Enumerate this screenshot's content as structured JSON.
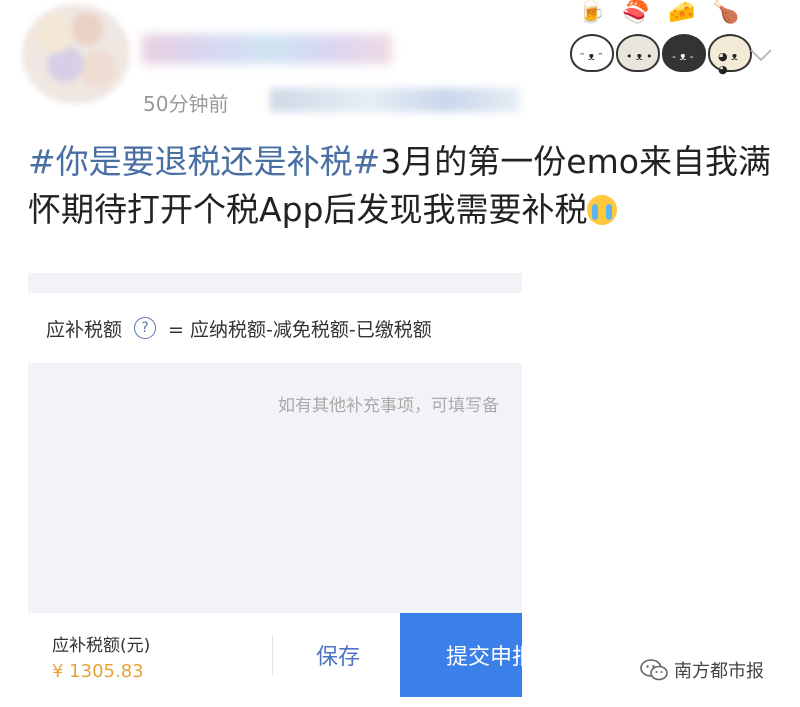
{
  "post": {
    "time": "50分钟前",
    "text": {
      "hashtag": "#你是要退税还是补税#",
      "line1_rest": "3月的第一份emo来自我满",
      "line2": "怀期待打开个税App后发现我需要补税"
    }
  },
  "stickers": [
    "cat-sticker-1",
    "cat-sticker-2",
    "cat-sticker-3",
    "cat-sticker-4"
  ],
  "tax_app": {
    "formula": {
      "label": "应补税额",
      "expression": "= 应纳税额-减免税额-已缴税额"
    },
    "note_placeholder": "如有其他补充事项，可填写备",
    "bottom_bar": {
      "due_label": "应补税额(元)",
      "due_amount": "¥ 1305.83",
      "save_label": "保存",
      "submit_label": "提交申报"
    }
  },
  "watermark": {
    "text": "南方都市报"
  },
  "colors": {
    "hashtag": "#4a6fa3",
    "submit_button": "#3b7fe8",
    "amount": "#e8a23a"
  }
}
